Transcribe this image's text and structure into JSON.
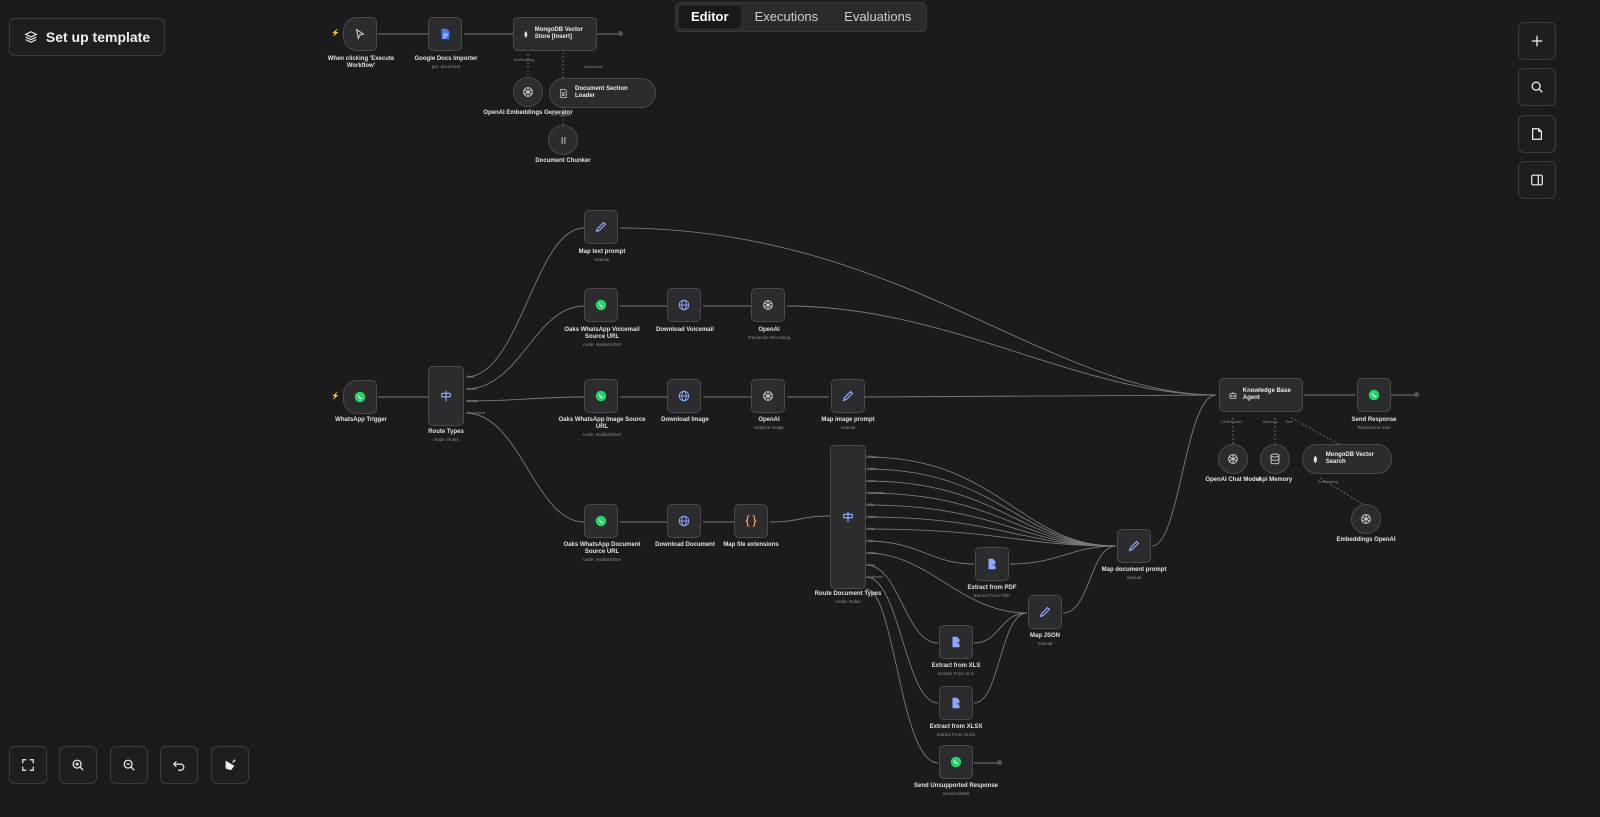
{
  "toolbar": {
    "setup_template_label": "Set up template"
  },
  "tabs": [
    {
      "label": "Editor",
      "active": true
    },
    {
      "label": "Executions",
      "active": false
    },
    {
      "label": "Evaluations",
      "active": false
    }
  ],
  "colors": {
    "background": "#1b1b1c",
    "node": "#2c2c2e",
    "edge": "#7a7a7a",
    "trigger_bolt": "#ff8a3d",
    "whatsapp": "#25d366",
    "openai": "#d0d0d0",
    "mongodb": "#e0e0e0"
  },
  "nodes": {
    "manual_trigger": {
      "title": "When clicking 'Execute Workflow'"
    },
    "gdocs": {
      "title": "Google Docs Importer",
      "subtitle": "get: document"
    },
    "mongo_insert": {
      "title": "MongoDB Vector Store [Insert]"
    },
    "embeddings_gen": {
      "title": "OpenAI Embeddings Generator"
    },
    "doc_loader": {
      "title": "Document Section Loader"
    },
    "chunker": {
      "title": "Document Chunker"
    },
    "map_text": {
      "title": "Map text prompt",
      "subtitle": "manual"
    },
    "voicemail_url": {
      "title": "Oaks WhatsApp Voicemail Source URL",
      "subtitle": "node: mediaUrlGet"
    },
    "download_voicemail": {
      "title": "Download Voicemail"
    },
    "openai_transcribe": {
      "title": "OpenAI",
      "subtitle": "Transcribe Recording"
    },
    "wa_trigger": {
      "title": "WhatsApp Trigger"
    },
    "route_types": {
      "title": "Route Types",
      "subtitle": "mode: Rules"
    },
    "image_url": {
      "title": "Oaks WhatsApp Image Source URL",
      "subtitle": "node: mediaUrlGet"
    },
    "download_image": {
      "title": "Download Image"
    },
    "openai_image": {
      "title": "OpenAI",
      "subtitle": "Analyze Image"
    },
    "map_image": {
      "title": "Map image prompt",
      "subtitle": "manual"
    },
    "kb_agent": {
      "title": "Knowledge Base Agent"
    },
    "send_response": {
      "title": "Send Response",
      "subtitle": "Respond to user"
    },
    "chat_model": {
      "title": "OpenAI Chat Model"
    },
    "memory": {
      "title": "Api Memory"
    },
    "mongo_search": {
      "title": "MongoDB Vector Search"
    },
    "embeddings_openai": {
      "title": "Embeddings OpenAI"
    },
    "doc_url": {
      "title": "Oaks WhatsApp Document Source URL",
      "subtitle": "node: mediaUrlGet"
    },
    "download_doc": {
      "title": "Download Document"
    },
    "map_ext": {
      "title": "Map file extensions"
    },
    "route_doc": {
      "title": "Route Document Types",
      "subtitle": "mode: Rules"
    },
    "extract_pdf": {
      "title": "Extract from PDF",
      "subtitle": "Extract From PDF"
    },
    "map_doc": {
      "title": "Map document prompt",
      "subtitle": "manual"
    },
    "map_json": {
      "title": "Map JSON",
      "subtitle": "manual"
    },
    "extract_xls": {
      "title": "Extract from XLS",
      "subtitle": "Extract From XLS"
    },
    "extract_xlsx": {
      "title": "Extract from XLSX",
      "subtitle": "Extract From XLSX"
    },
    "send_unsupported": {
      "title": "Send Unsupported Response",
      "subtitle": "sendAndWait"
    }
  },
  "port_labels": {
    "mongo_embedding": "Embedding",
    "mongo_document": "Document",
    "loader_splitter": "Text Splitter",
    "route_types": [
      "Text",
      "Audio",
      "Image",
      "Document"
    ],
    "route_doc": [
      "Plain",
      "Html",
      "Csv",
      "Calendar",
      "Rtf",
      "Json",
      "Pdf",
      "Xls",
      "Xlsx",
      "Xml",
      "Fallback"
    ],
    "agent_chat_model": "Chat Model",
    "agent_memory": "Memory",
    "agent_tool": "Tool",
    "search_embedding": "Embedding"
  }
}
